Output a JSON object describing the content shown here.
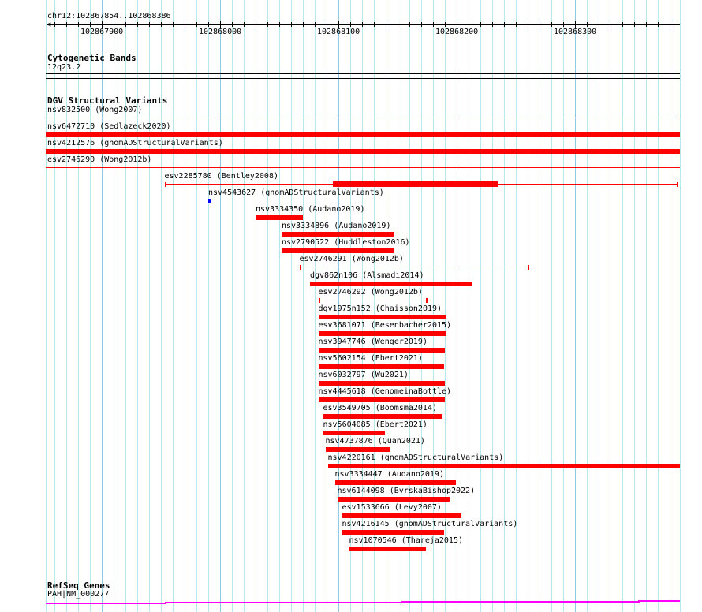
{
  "ruler": {
    "location": "chr12:102867854..102868386",
    "view_start": 102867854,
    "view_end": 102868386,
    "major_labels": [
      "102867900",
      "102868000",
      "102868100",
      "102868200",
      "102868300"
    ]
  },
  "tracks": {
    "cytoband": {
      "title": "Cytogenetic Bands",
      "band": "12q23.2"
    },
    "dgv": {
      "title": "DGV Structural Variants",
      "features": [
        {
          "label": "nsv832500 (Wong2007)",
          "start": 102867800,
          "end": 102868400,
          "style": "thin"
        },
        {
          "label": "nsv6472710 (Sedlazeck2020)",
          "start": 102867800,
          "end": 102868400,
          "style": "thick"
        },
        {
          "label": "nsv4212576 (gnomADStructuralVariants)",
          "start": 102867800,
          "end": 102868400,
          "style": "thick"
        },
        {
          "label": "esv2746290 (Wong2012b)",
          "start": 102867800,
          "end": 102868400,
          "style": "thin"
        },
        {
          "label": "esv2285780 (Bentley2008)",
          "start": 102867953,
          "end": 102868387,
          "style": "thin",
          "thick_start": 102868095,
          "thick_end": 102868235
        },
        {
          "label": "nsv4543627 (gnomADStructuralVariants)",
          "start": 102867990,
          "end": 102867992,
          "style": "blue"
        },
        {
          "label": "nsv3334350 (Audano2019)",
          "start": 102868030,
          "end": 102868070,
          "style": "thick"
        },
        {
          "label": "nsv3334896 (Audano2019)",
          "start": 102868052,
          "end": 102868147,
          "style": "thick"
        },
        {
          "label": "nsv2790522 (Huddleston2016)",
          "start": 102868052,
          "end": 102868147,
          "style": "thick"
        },
        {
          "label": "esv2746291 (Wong2012b)",
          "start": 102868067,
          "end": 102868261,
          "style": "thin"
        },
        {
          "label": "dgv862n106 (Alsmadi2014)",
          "start": 102868076,
          "end": 102868213,
          "style": "thick"
        },
        {
          "label": "esv2746292 (Wong2012b)",
          "start": 102868083,
          "end": 102868175,
          "style": "thin"
        },
        {
          "label": "dgv1975n152 (Chaisson2019)",
          "start": 102868083,
          "end": 102868191,
          "style": "thick"
        },
        {
          "label": "esv3681071 (Besenbacher2015)",
          "start": 102868083,
          "end": 102868191,
          "style": "thick"
        },
        {
          "label": "nsv3947746 (Wenger2019)",
          "start": 102868083,
          "end": 102868190,
          "style": "thick"
        },
        {
          "label": "nsv5602154 (Ebert2021)",
          "start": 102868083,
          "end": 102868189,
          "style": "thick"
        },
        {
          "label": "nsv6032797 (Wu2021)",
          "start": 102868083,
          "end": 102868190,
          "style": "thick"
        },
        {
          "label": "nsv4445618 (GenomeinaBottle)",
          "start": 102868083,
          "end": 102868190,
          "style": "thick"
        },
        {
          "label": "esv3549705 (Boomsma2014)",
          "start": 102868087,
          "end": 102868188,
          "style": "thick"
        },
        {
          "label": "nsv5604085 (Ebert2021)",
          "start": 102868087,
          "end": 102868139,
          "style": "thick"
        },
        {
          "label": "nsv4737876 (Quan2021)",
          "start": 102868089,
          "end": 102868144,
          "style": "thick"
        },
        {
          "label": "nsv4220161 (gnomADStructuralVariants)",
          "start": 102868091,
          "end": 102868400,
          "style": "thick"
        },
        {
          "label": "nsv3334447 (Audano2019)",
          "start": 102868097,
          "end": 102868199,
          "style": "thick"
        },
        {
          "label": "nsv6144098 (ByrskaBishop2022)",
          "start": 102868099,
          "end": 102868194,
          "style": "thick"
        },
        {
          "label": "esv1533666 (Levy2007)",
          "start": 102868103,
          "end": 102868204,
          "style": "thick"
        },
        {
          "label": "nsv4216145 (gnomADStructuralVariants)",
          "start": 102868103,
          "end": 102868189,
          "style": "thick"
        },
        {
          "label": "nsv1070546 (Thareja2015)",
          "start": 102868109,
          "end": 102868174,
          "style": "thick"
        }
      ]
    },
    "refseq": {
      "title": "RefSeq Genes",
      "gene": "PAH|NM_000277"
    }
  },
  "colors": {
    "variant": "#ff0000",
    "variant_blue": "#0000ff",
    "gene": "#ff00ff",
    "grid": "#b4e8ee",
    "grid_major": "#8ccbe0"
  }
}
